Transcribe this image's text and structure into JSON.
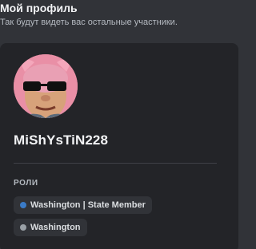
{
  "header": {
    "title": "Мой профиль",
    "subtitle": "Так будут видеть вас остальные участники."
  },
  "profile": {
    "username": "MiShYsTiN228",
    "avatar_icon": "avatar-pig-with-sunglasses"
  },
  "roles": {
    "label": "РОЛИ",
    "items": [
      {
        "name": "Washington | State Member",
        "color": "#3a7bc8"
      },
      {
        "name": "Washington",
        "color": "#9aa0a6"
      }
    ]
  },
  "colors": {
    "background": "#313338",
    "card": "#232428",
    "pill": "#313338",
    "text_primary": "#f2f3f5",
    "text_muted": "#b5bac1"
  }
}
